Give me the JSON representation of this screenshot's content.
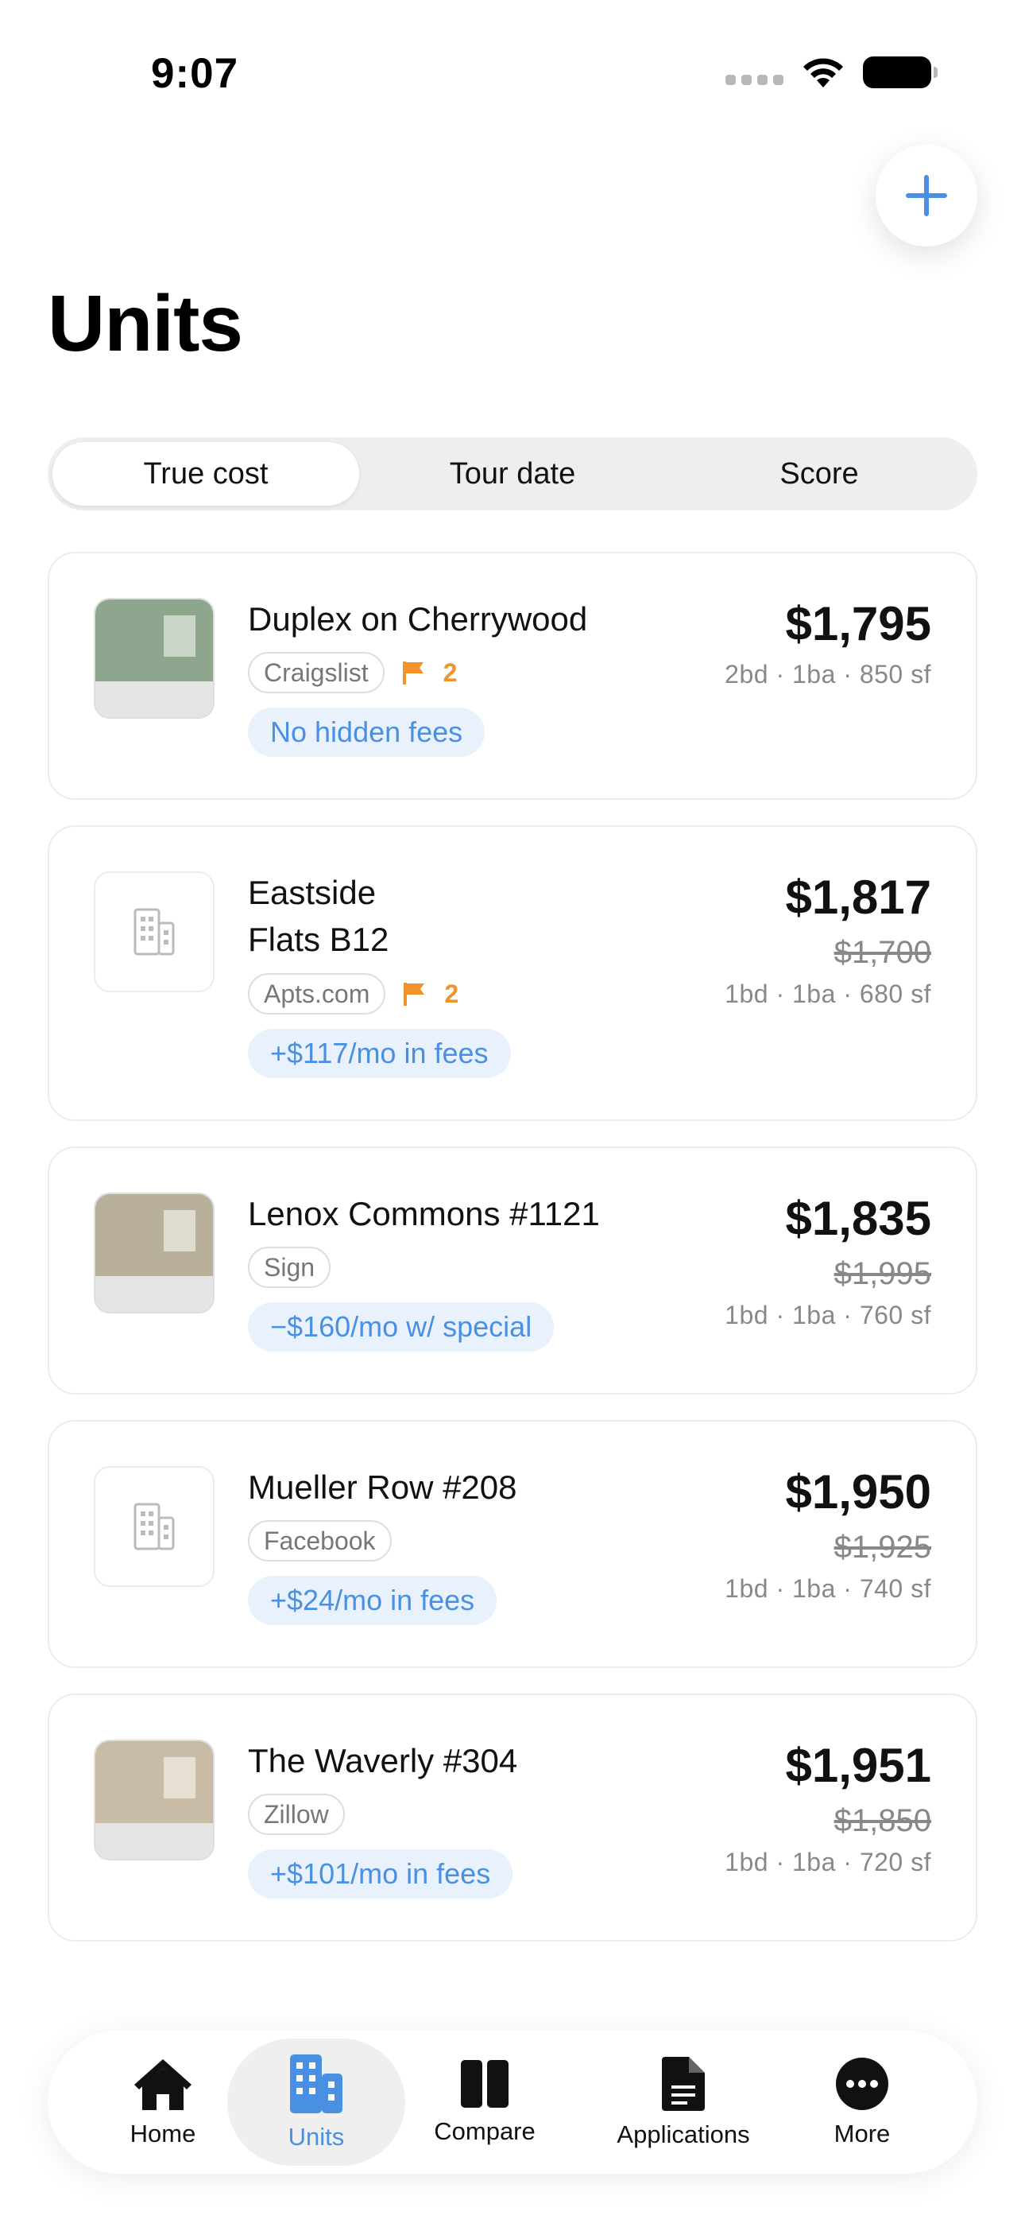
{
  "status": {
    "time": "9:07"
  },
  "header": {
    "title": "Units",
    "add_icon": "plus-icon"
  },
  "segments": [
    {
      "label": "True cost",
      "active": true
    },
    {
      "label": "Tour date",
      "active": false
    },
    {
      "label": "Score",
      "active": false
    }
  ],
  "units": [
    {
      "name_line1": "Duplex on Cherrywood",
      "name_line2": "",
      "source": "Craigslist",
      "flags": "2",
      "pill": "No hidden fees",
      "price": "$1,795",
      "old_price": "",
      "meta": "2bd · 1ba · 850 sf",
      "thumb": {
        "type": "photo",
        "color": "#8fa68e",
        "window": "#c9d5c6"
      }
    },
    {
      "name_line1": "Eastside",
      "name_line2": "Flats B12",
      "source": "Apts.com",
      "flags": "2",
      "pill": "+$117/mo in fees",
      "price": "$1,817",
      "old_price": "$1,700",
      "meta": "1bd · 1ba · 680 sf",
      "thumb": {
        "type": "blank",
        "icon": "building-icon"
      }
    },
    {
      "name_line1": "Lenox Commons #1121",
      "name_line2": "",
      "source": "Sign",
      "flags": "",
      "pill": "−$160/mo w/ special",
      "price": "$1,835",
      "old_price": "$1,995",
      "meta": "1bd · 1ba · 760 sf",
      "thumb": {
        "type": "photo",
        "color": "#b9b09c",
        "window": "#dfdbd1"
      }
    },
    {
      "name_line1": "Mueller Row #208",
      "name_line2": "",
      "source": "Facebook",
      "flags": "",
      "pill": "+$24/mo in fees",
      "price": "$1,950",
      "old_price": "$1,925",
      "meta": "1bd · 1ba · 740 sf",
      "thumb": {
        "type": "blank",
        "icon": "building-icon"
      }
    },
    {
      "name_line1": "The Waverly #304",
      "name_line2": "",
      "source": "Zillow",
      "flags": "",
      "pill": "+$101/mo in fees",
      "price": "$1,951",
      "old_price": "$1,850",
      "meta": "1bd · 1ba · 720 sf",
      "thumb": {
        "type": "photo",
        "color": "#c8bca6",
        "window": "#e6e0d4"
      }
    }
  ],
  "tabs": [
    {
      "label": "Home",
      "icon": "house-icon",
      "active": false
    },
    {
      "label": "Units",
      "icon": "buildings-icon",
      "active": true
    },
    {
      "label": "Compare",
      "icon": "columns-icon",
      "active": false
    },
    {
      "label": "Applications",
      "icon": "document-icon",
      "active": false
    },
    {
      "label": "More",
      "icon": "ellipsis-icon",
      "active": false
    }
  ],
  "colors": {
    "accent": "#4a90e2",
    "flag": "#f2922b",
    "pill_bg": "#e8f1fc"
  }
}
